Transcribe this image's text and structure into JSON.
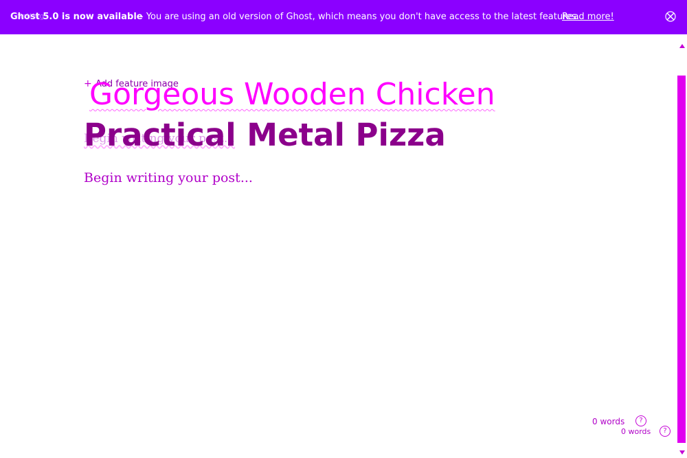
{
  "banner": {
    "bold_text": "Ghost 5.0 is now available",
    "overlay_text": "Settings",
    "message": "- You are using an old version of Ghost, which means you don't have access to the latest features.",
    "link_label": "Read more!",
    "close_icon": "close-icon",
    "background": "#8b00ff"
  },
  "editor": {
    "add_feature_label": "Add feature image",
    "ghost_title": "Gorgeous Wooden Chicken",
    "title": "Practical Metal Pizza",
    "ghost_body_placeholder": "Begin writing your post...",
    "body_placeholder": "Begin writing your post..."
  },
  "footer": {
    "word_count_primary": "0 words",
    "word_count_secondary": "0 words",
    "help_symbol": "?"
  },
  "colors": {
    "accent": "#ff00ff",
    "title": "#8b008b",
    "scrollbar": "#e000f0"
  }
}
